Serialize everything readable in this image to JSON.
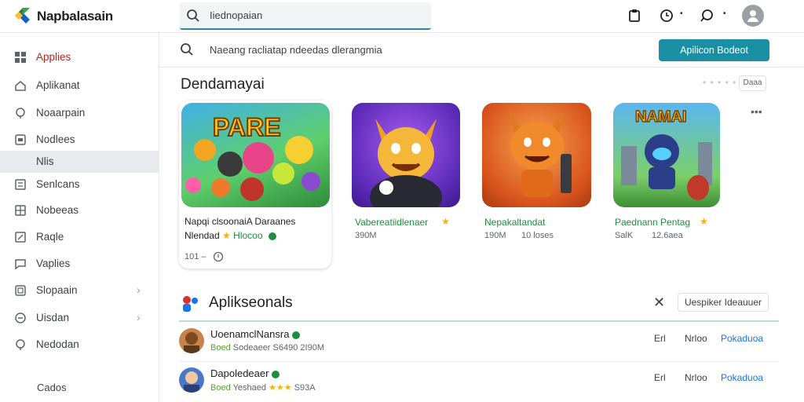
{
  "app": {
    "name": "Napbalasain"
  },
  "search": {
    "query": "Iiednopaian"
  },
  "subbar": {
    "text": "Naeang racliatap   ndeedas dlerangmia"
  },
  "primary_button": "Apilicon Bodeot",
  "sidebar": {
    "items": [
      {
        "label": "Applies",
        "icon": "grid-icon"
      },
      {
        "label": "Aplikanat",
        "icon": "home-icon"
      },
      {
        "label": "Noaarpain",
        "icon": "pin-icon"
      },
      {
        "label": "Nodlees",
        "icon": "box-icon"
      },
      {
        "label": "Nlis"
      },
      {
        "label": "Senlcans",
        "icon": "list-icon"
      },
      {
        "label": "Nobeeas",
        "icon": "grid-icon"
      },
      {
        "label": "Raqle",
        "icon": "edit-icon"
      },
      {
        "label": "Vaplies",
        "icon": "chat-icon"
      },
      {
        "label": "Slopaain",
        "icon": "box-icon"
      },
      {
        "label": "Uisdan",
        "icon": "circle-icon"
      },
      {
        "label": "Nedodan",
        "icon": "pin-icon"
      }
    ],
    "footer": "Cados"
  },
  "section1": {
    "title": "Dendamayai",
    "mini_button": "Daaa"
  },
  "cards": [
    {
      "thumb_text": "PARE",
      "title": "Napqi clsoonaiA Daraanes",
      "sub": "Nlendad",
      "badge": "Hlocoo",
      "meta": "101 –"
    },
    {
      "title": "Vabereatiidlenaer",
      "sub": "390M"
    },
    {
      "title": "Nepakaltandat",
      "sub": "190M",
      "extra": "10 loses"
    },
    {
      "thumb_text": "NAMAI",
      "title": "Paednann Pentag",
      "sub": "SalK",
      "extra": "12.6aea"
    }
  ],
  "section2": {
    "title": "Aplikseonals",
    "button": "Uespiker Ideauuer"
  },
  "rows": [
    {
      "name": "UoenamclNansra",
      "tag": "Boed",
      "sub": "Sodeaeer",
      "size": "S6490 2I90M",
      "c1": "Erl",
      "c2": "Nrloo",
      "c3": "Pokaduoa"
    },
    {
      "name": "Dapoledeaer",
      "tag": "Boed",
      "sub": "Yeshaed",
      "size": "S93A",
      "c1": "Erl",
      "c2": "Nrloo",
      "c3": "Pokaduoa"
    }
  ]
}
